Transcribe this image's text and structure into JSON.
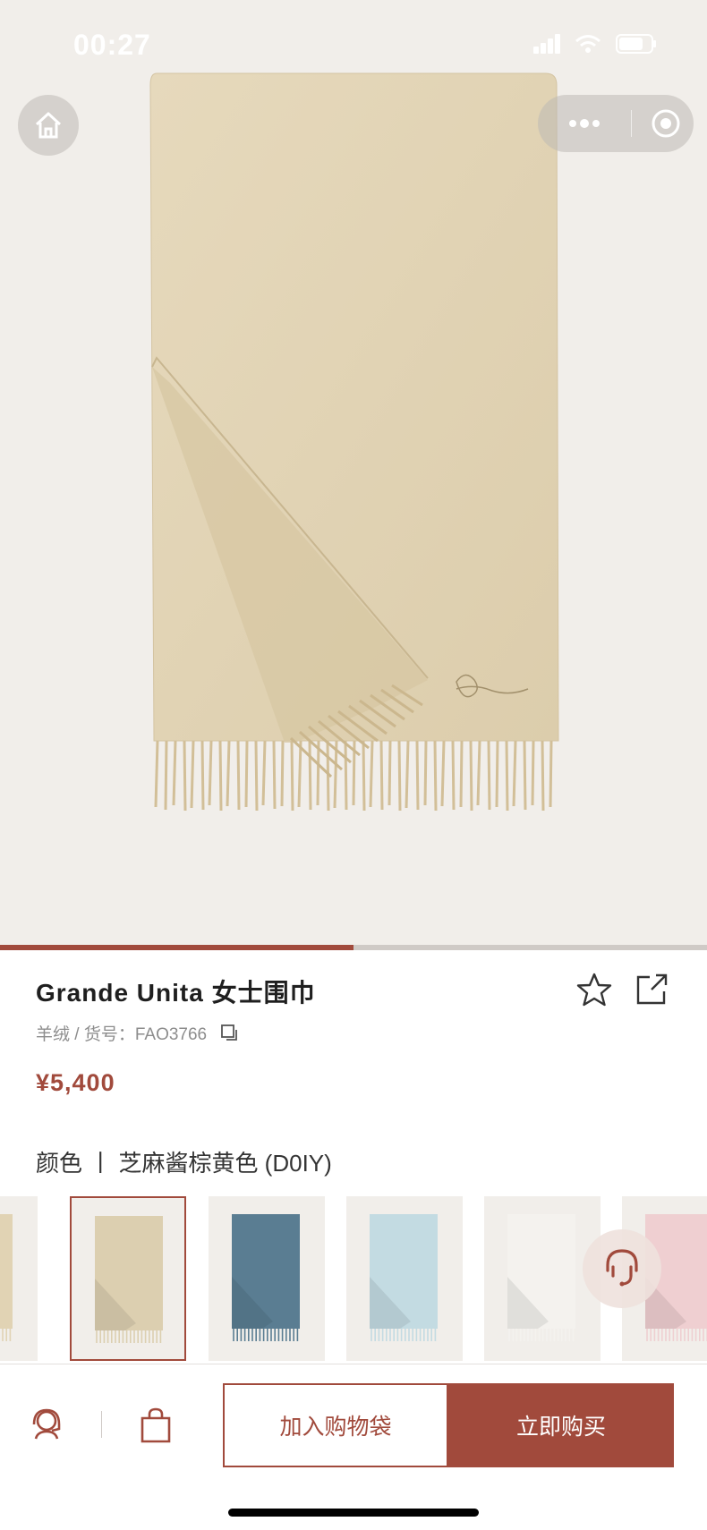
{
  "status_bar": {
    "time": "00:27"
  },
  "gallery": {
    "progress": 0.5,
    "product_image_icon": "scarf-image"
  },
  "product": {
    "title": "Grande Unita 女士围巾",
    "material_sku": "羊绒 / 货号：FAO3766",
    "price": "¥5,400",
    "color_label": "颜色 丨 芝麻酱棕黄色 (D0IY)"
  },
  "swatches": [
    {
      "color": "#e1d3b4",
      "selected": false
    },
    {
      "color": "#dccfb0",
      "selected": true
    },
    {
      "color": "#5a7d92",
      "selected": false
    },
    {
      "color": "#c3dbe2",
      "selected": false
    },
    {
      "color": "#f4f2ee",
      "selected": false
    },
    {
      "color": "#efcfd1",
      "selected": false
    }
  ],
  "bottom_bar": {
    "add_to_bag_label": "加入购物袋",
    "buy_now_label": "立即购买"
  },
  "colors": {
    "accent": "#a14a3c",
    "background": "#f1eeea",
    "scarf": "#e3d5b7"
  }
}
